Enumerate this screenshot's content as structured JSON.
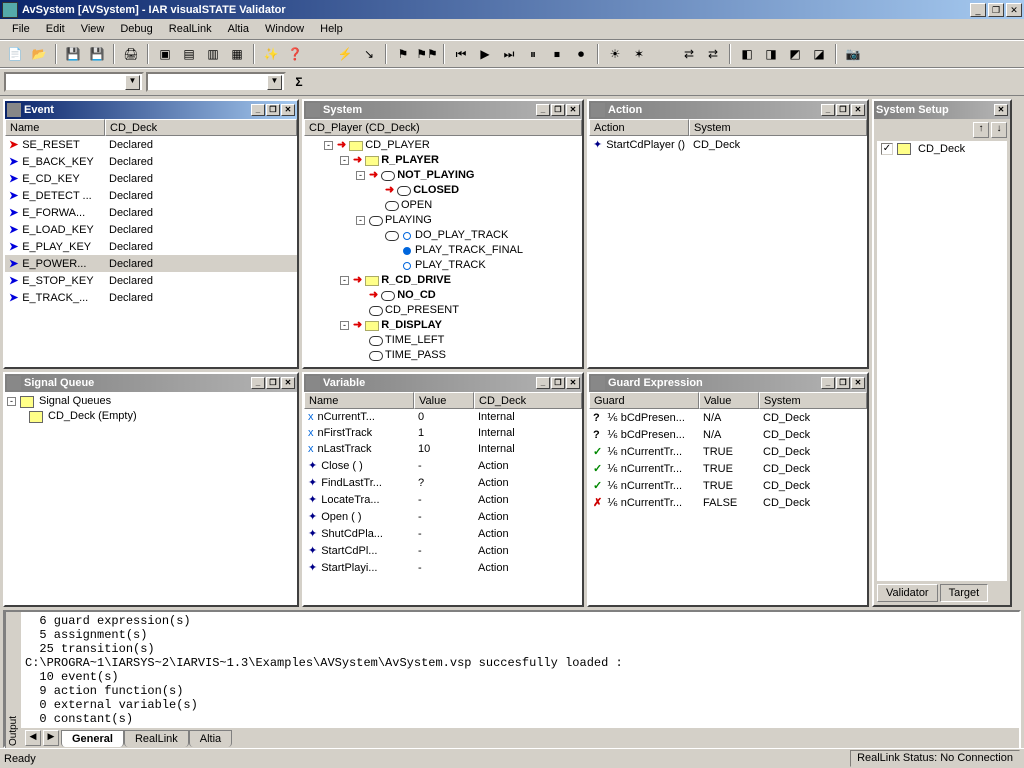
{
  "window": {
    "title": "AvSystem [AVSystem]  - IAR visualSTATE Validator",
    "min": "_",
    "max": "❐",
    "close": "✕"
  },
  "menu": [
    "File",
    "Edit",
    "View",
    "Debug",
    "RealLink",
    "Altia",
    "Window",
    "Help"
  ],
  "panels": {
    "event": {
      "title": "Event",
      "cols": [
        "Name",
        "CD_Deck"
      ],
      "rows": [
        {
          "name": "SE_RESET",
          "status": "Declared",
          "c": "red"
        },
        {
          "name": "E_BACK_KEY",
          "status": "Declared",
          "c": "blue"
        },
        {
          "name": "E_CD_KEY",
          "status": "Declared",
          "c": "blue"
        },
        {
          "name": "E_DETECT ...",
          "status": "Declared",
          "c": "blue"
        },
        {
          "name": "E_FORWA...",
          "status": "Declared",
          "c": "blue"
        },
        {
          "name": "E_LOAD_KEY",
          "status": "Declared",
          "c": "blue"
        },
        {
          "name": "E_PLAY_KEY",
          "status": "Declared",
          "c": "blue"
        },
        {
          "name": "E_POWER...",
          "status": "Declared",
          "c": "blue",
          "sel": true
        },
        {
          "name": "E_STOP_KEY",
          "status": "Declared",
          "c": "blue"
        },
        {
          "name": "E_TRACK_...",
          "status": "Declared",
          "c": "blue"
        }
      ]
    },
    "system": {
      "title": "System",
      "root": "CD_Player (CD_Deck)",
      "tree": [
        {
          "ind": 1,
          "exp": "-",
          "icon": "folder",
          "arrow": true,
          "label": "CD_PLAYER"
        },
        {
          "ind": 2,
          "exp": "-",
          "icon": "folder",
          "arrow": true,
          "bold": true,
          "label": "R_PLAYER"
        },
        {
          "ind": 3,
          "exp": "-",
          "icon": "state",
          "arrow": true,
          "bold": true,
          "label": "NOT_PLAYING"
        },
        {
          "ind": 4,
          "icon": "state",
          "arrow": true,
          "bold": true,
          "label": "CLOSED"
        },
        {
          "ind": 4,
          "icon": "state",
          "label": "OPEN"
        },
        {
          "ind": 3,
          "exp": "-",
          "icon": "state",
          "label": "PLAYING"
        },
        {
          "ind": 4,
          "icon": "state",
          "dot": true,
          "label": "DO_PLAY_TRACK"
        },
        {
          "ind": 5,
          "icon": "none",
          "dot": "fill",
          "label": "PLAY_TRACK_FINAL"
        },
        {
          "ind": 5,
          "icon": "none",
          "dot": true,
          "label": "PLAY_TRACK"
        },
        {
          "ind": 2,
          "exp": "-",
          "icon": "folder",
          "arrow": true,
          "bold": true,
          "label": "R_CD_DRIVE"
        },
        {
          "ind": 3,
          "icon": "state",
          "arrow": true,
          "bold": true,
          "label": "NO_CD"
        },
        {
          "ind": 3,
          "icon": "state",
          "label": "CD_PRESENT"
        },
        {
          "ind": 2,
          "exp": "-",
          "icon": "folder",
          "arrow": true,
          "bold": true,
          "label": "R_DISPLAY"
        },
        {
          "ind": 3,
          "icon": "state",
          "label": "TIME_LEFT"
        },
        {
          "ind": 3,
          "icon": "state",
          "label": "TIME_PASS"
        }
      ]
    },
    "action": {
      "title": "Action",
      "cols": [
        "Action",
        "System"
      ],
      "rows": [
        {
          "action": "StartCdPlayer ()",
          "system": "CD_Deck"
        }
      ]
    },
    "signal": {
      "title": "Signal Queue",
      "root": "Signal Queues",
      "child": "CD_Deck (Empty)"
    },
    "variable": {
      "title": "Variable",
      "cols": [
        "Name",
        "Value",
        "CD_Deck"
      ],
      "rows": [
        {
          "name": "nCurrentT...",
          "value": "0",
          "src": "Internal",
          "t": "var"
        },
        {
          "name": "nFirstTrack",
          "value": "1",
          "src": "Internal",
          "t": "var"
        },
        {
          "name": "nLastTrack",
          "value": "10",
          "src": "Internal",
          "t": "var"
        },
        {
          "name": "Close ( )",
          "value": "-",
          "src": "Action",
          "t": "act"
        },
        {
          "name": "FindLastTr...",
          "value": "?",
          "src": "Action",
          "t": "act"
        },
        {
          "name": "LocateTra...",
          "value": "-",
          "src": "Action",
          "t": "act"
        },
        {
          "name": "Open ( )",
          "value": "-",
          "src": "Action",
          "t": "act"
        },
        {
          "name": "ShutCdPla...",
          "value": "-",
          "src": "Action",
          "t": "act"
        },
        {
          "name": "StartCdPl...",
          "value": "-",
          "src": "Action",
          "t": "act"
        },
        {
          "name": "StartPlayi...",
          "value": "-",
          "src": "Action",
          "t": "act"
        }
      ]
    },
    "guard": {
      "title": "Guard Expression",
      "cols": [
        "Guard",
        "Value",
        "System"
      ],
      "rows": [
        {
          "s": "q",
          "name": "bCdPresen...",
          "value": "N/A",
          "system": "CD_Deck"
        },
        {
          "s": "q",
          "name": "bCdPresen...",
          "value": "N/A",
          "system": "CD_Deck"
        },
        {
          "s": "ok",
          "name": "nCurrentTr...",
          "value": "TRUE",
          "system": "CD_Deck"
        },
        {
          "s": "ok",
          "name": "nCurrentTr...",
          "value": "TRUE",
          "system": "CD_Deck"
        },
        {
          "s": "ok",
          "name": "nCurrentTr...",
          "value": "TRUE",
          "system": "CD_Deck"
        },
        {
          "s": "no",
          "name": "nCurrentTr...",
          "value": "FALSE",
          "system": "CD_Deck"
        }
      ]
    },
    "setup": {
      "title": "System Setup",
      "item": "CD_Deck",
      "tabs": [
        "Validator",
        "Target"
      ]
    }
  },
  "output": {
    "label": "Output",
    "lines": [
      "  6 guard expression(s)",
      "  5 assignment(s)",
      "  25 transition(s)",
      "C:\\PROGRA~1\\IARSYS~2\\IARVIS~1.3\\Examples\\AVSystem\\AvSystem.vsp succesfully loaded :",
      "  10 event(s)",
      "  9 action function(s)",
      "  0 external variable(s)",
      "  0 constant(s)"
    ],
    "tabs": [
      "General",
      "RealLink",
      "Altia"
    ]
  },
  "status": {
    "left": "Ready",
    "right": "RealLink Status: No Connection"
  }
}
